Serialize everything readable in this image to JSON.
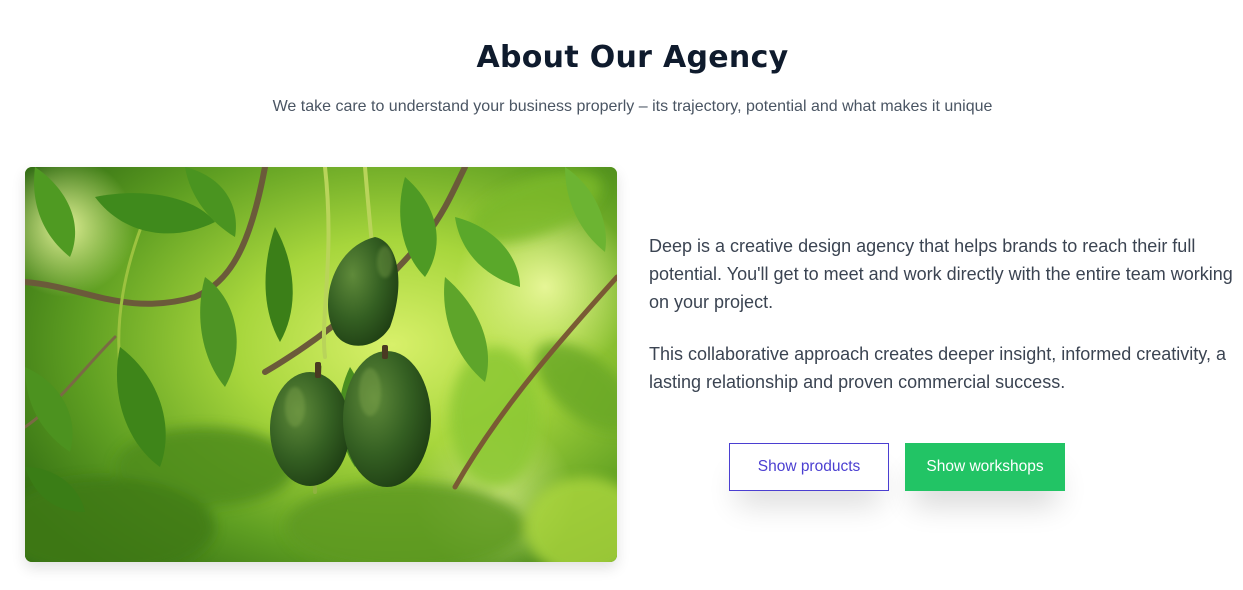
{
  "section": {
    "title": "About Our Agency",
    "subtitle": "We take care to understand your business properly – its trajectory, potential and what makes it unique"
  },
  "image": {
    "alt": "Avocados hanging on a branch",
    "icon": "photo-avocado-tree"
  },
  "body": {
    "paragraphs": [
      "Deep is a creative design agency that helps brands to reach their full potential. You'll get to meet and work directly with the entire team working on your project.",
      "This collaborative approach creates deeper insight, informed creativity, a lasting relationship and proven commercial success."
    ]
  },
  "buttons": {
    "show_products": "Show products",
    "show_workshops": "Show workshops"
  },
  "colors": {
    "heading": "#0f1b2d",
    "text": "#3b4452",
    "outline_accent": "#4b3fd1",
    "primary_green": "#22c465"
  }
}
